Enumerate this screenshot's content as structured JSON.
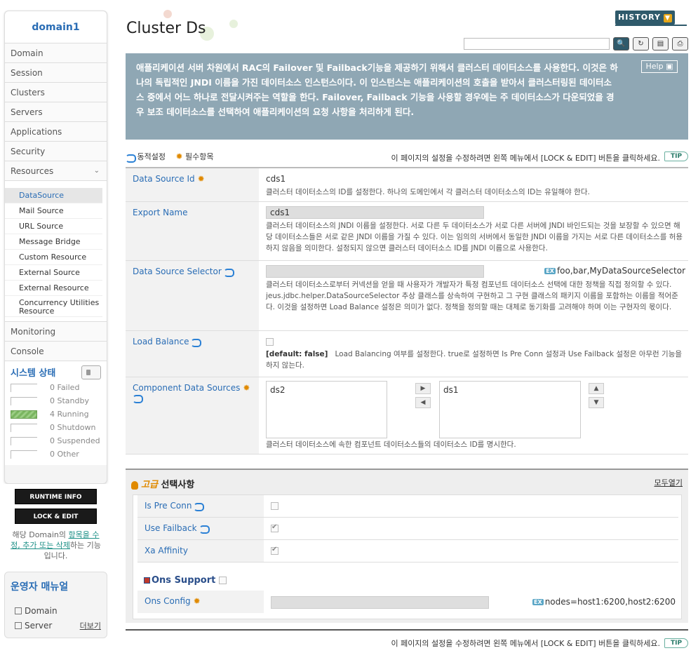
{
  "sidebar": {
    "domain_title": "domain1",
    "nav": [
      "Domain",
      "Session",
      "Clusters",
      "Servers",
      "Applications",
      "Security",
      "Resources"
    ],
    "resources_sub": [
      "DataSource",
      "Mail Source",
      "URL Source",
      "Message Bridge",
      "Custom Resource",
      "External Source",
      "External Resource",
      "Concurrency Utilities Resource"
    ],
    "nav_after": [
      "Monitoring",
      "Console"
    ],
    "system_status": {
      "title": "시스템 상태",
      "rows": [
        {
          "count": "0",
          "label": "Failed"
        },
        {
          "count": "0",
          "label": "Standby"
        },
        {
          "count": "4",
          "label": "Running"
        },
        {
          "count": "0",
          "label": "Shutdown"
        },
        {
          "count": "0",
          "label": "Suspended"
        },
        {
          "count": "0",
          "label": "Other"
        }
      ]
    },
    "runtime_info": "RUNTIME INFO",
    "lock_edit": "LOCK & EDIT",
    "note_pre": "해당 Domain의 ",
    "note_link": "항목을 수정, 추가 또는 삭제",
    "note_post": "하는 기능입니다.",
    "manual": {
      "title": "운영자 매뉴얼",
      "items": [
        "Domain",
        "Server"
      ],
      "more": "더보기"
    }
  },
  "header": {
    "title": "Cluster Ds",
    "history": "HISTORY",
    "search_placeholder": ""
  },
  "description": "애플리케이션 서버 차원에서 RAC의 Failover 및 Failback기능을 제공하기 위해서 클러스터 데이터소스를 사용한다. 이것은 하나의 독립적인 JNDI 이름을 가진 데이터소스 인스턴스이다. 이 인스턴스는 애플리케이션의 호출을 받아서 클러스터링된 데이터소스 중에서 어느 하나로 전달시켜주는 역할을 한다. Failover, Failback 기능을 사용할 경우에는 주 데이터소스가 다운되었을 경우 보조 데이터소스를 선택하여 애플리케이션의 요청 사항을 처리하게 된다.",
  "help_label": "Help",
  "legend": {
    "dynamic": "동적설정",
    "required": "필수항목",
    "notice": "이 페이지의 설정을 수정하려면 왼쪽 메뉴에서 [LOCK & EDIT] 버튼을 클릭하세요.",
    "tip": "TIP"
  },
  "fields": {
    "ds_id": {
      "label": "Data Source Id",
      "value": "cds1",
      "help": "클러스터 데이터소스의 ID를 설정한다. 하나의 도메인에서 각 클러스터 데이터소스의 ID는 유일해야 한다."
    },
    "export_name": {
      "label": "Export Name",
      "value": "cds1",
      "help": "클러스터 데이터소스의 JNDI 이름을 설정한다. 서로 다른 두 데이터소스가 서로 다른 서버에 JNDI 바인드되는 것을 보장할 수 있으면 해당 데이터소스들은 서로 같은 JNDI 이름을 가질 수 있다. 이는 임의의 서버에서 동일한 JNDI 이름을 가지는 서로 다른 데이터소스를 허용하지 않음을 의미한다. 설정되지 않으면 클러스터 데이터소스 ID를 JNDI 이름으로 사용한다."
    },
    "selector": {
      "label": "Data Source Selector",
      "value": "",
      "example_badge": "EX",
      "example": "foo,bar,MyDataSourceSelector",
      "help": "클러스터 데이터소스로부터 커넥션을 얻을 때 사용자가 개발자가 특정 컴포넌트 데이터소스 선택에 대한 정책을 직접 정의할 수 있다. jeus.jdbc.helper.DataSourceSelector 추상 클래스를 상속하여 구현하고 그 구현 클래스의 패키지 이름을 포함하는 이름을 적어준다. 이것을 설정하면 Load Balance 설정은 의미가 없다. 정책을 정의할 때는 대체로 동기화를 고려해야 하며 이는 구현자의 몫이다."
    },
    "load_balance": {
      "label": "Load Balance",
      "default": "[default: false]",
      "help": "Load Balancing 여부를 설정한다. true로 설정하면 Is Pre Conn 설정과 Use Failback 설정은 아무런 기능을 하지 않는다."
    },
    "component": {
      "label": "Component Data Sources",
      "available": [
        "ds2"
      ],
      "selected": [
        "ds1"
      ],
      "help": "클러스터 데이터소스에 속한 컴포넌트 데이터소스들의 데이터소스 ID를 명시한다."
    }
  },
  "advanced": {
    "title_em": "고급",
    "title_rest": " 선택사항",
    "expand_all": "모두열기",
    "is_pre_conn": "Is Pre Conn",
    "use_failback": "Use Failback",
    "xa_affinity": "Xa Affinity",
    "ons_support": "Ons Support",
    "ons_config": "Ons Config",
    "ons_example_badge": "EX",
    "ons_example": "nodes=host1:6200,host2:6200"
  }
}
